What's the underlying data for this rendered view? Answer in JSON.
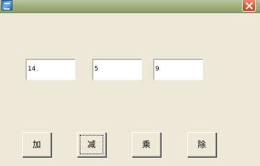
{
  "window": {
    "title": ""
  },
  "fields": [
    {
      "value": "14"
    },
    {
      "value": "5"
    },
    {
      "value": "9"
    }
  ],
  "buttons": {
    "add_label": "加",
    "subtract_label": "减",
    "multiply_label": "乘",
    "divide_label": "除"
  },
  "icons": {
    "app": "app-icon",
    "close": "close-icon"
  },
  "colors": {
    "window_background": "#ece9d8",
    "titlebar": "#a3b17f",
    "close_button": "#d2603b",
    "field_background": "#ffffff"
  }
}
